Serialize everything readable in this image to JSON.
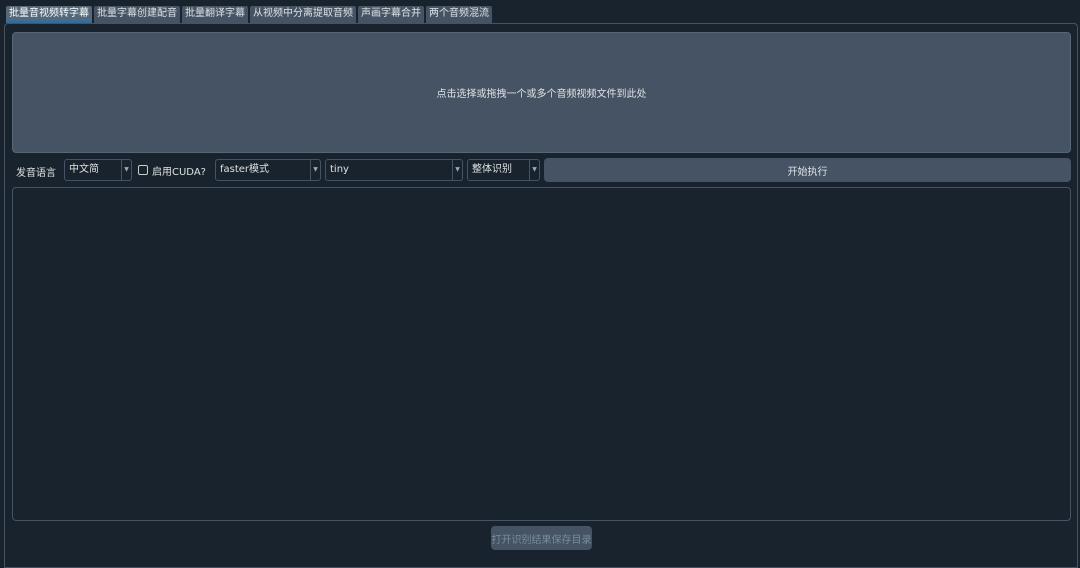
{
  "tabs": [
    {
      "label": "批量音视频转字幕",
      "active": true
    },
    {
      "label": "批量字幕创建配音",
      "active": false
    },
    {
      "label": "批量翻译字幕",
      "active": false
    },
    {
      "label": "从视频中分离提取音频",
      "active": false
    },
    {
      "label": "声画字幕合并",
      "active": false
    },
    {
      "label": "两个音频混流",
      "active": false
    }
  ],
  "dropzone": {
    "text": "点击选择或拖拽一个或多个音频视频文件到此处"
  },
  "toolbar": {
    "language_label": "发音语言",
    "language_value": "中文简",
    "cuda_label": "启用CUDA?",
    "cuda_checked": false,
    "mode_value": "faster模式",
    "model_value": "tiny",
    "split_value": "整体识别",
    "start_label": "开始执行"
  },
  "output": {
    "text": ""
  },
  "open_dir_label": "打开识别结果保存目录",
  "icons": {
    "dropdown": "chevron-down-icon",
    "checkbox": "checkbox-icon"
  },
  "colors": {
    "background": "#19232d",
    "surface": "#455364",
    "accent": "#1a72bb",
    "text": "#dfe1e2",
    "disabled_text": "#788d9c"
  }
}
